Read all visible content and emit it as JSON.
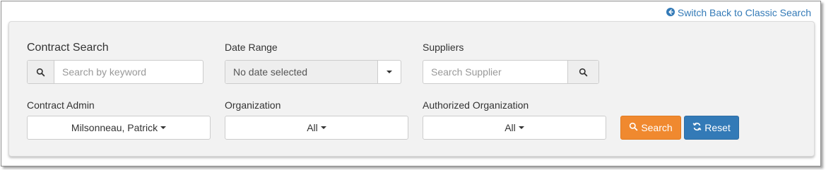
{
  "header": {
    "switch_link": "Switch Back to Classic Search",
    "switch_icon": "circle-arrow-left-icon"
  },
  "contract_search": {
    "label": "Contract Search",
    "placeholder": "Search by keyword",
    "value": "",
    "icon": "search-icon"
  },
  "date_range": {
    "label": "Date Range",
    "value": "No date selected"
  },
  "suppliers": {
    "label": "Suppliers",
    "placeholder": "Search Supplier",
    "value": "",
    "icon": "search-icon"
  },
  "contract_admin": {
    "label": "Contract Admin",
    "value": "Milsonneau, Patrick"
  },
  "organization": {
    "label": "Organization",
    "value": "All"
  },
  "authorized_organization": {
    "label": "Authorized Organization",
    "value": "All"
  },
  "actions": {
    "search_label": "Search",
    "reset_label": "Reset"
  },
  "colors": {
    "link": "#337ab7",
    "search_button": "#f0892f",
    "reset_button": "#337ab7",
    "panel_bg": "#f2f2f2"
  }
}
